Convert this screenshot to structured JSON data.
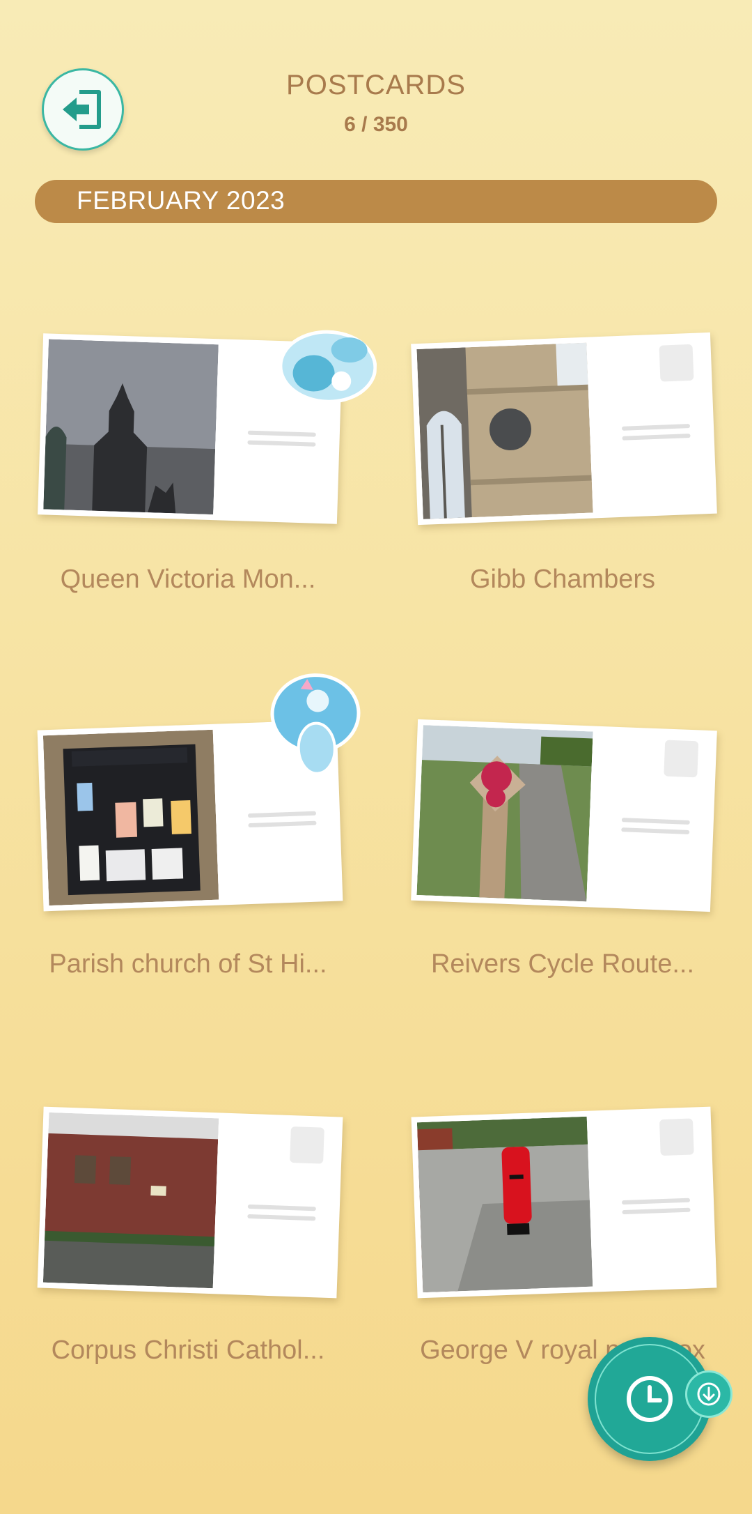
{
  "header": {
    "title": "POSTCARDS",
    "count": "6 / 350",
    "back_icon": "exit-door-icon"
  },
  "month": "FEBRUARY 2023",
  "postcards": [
    {
      "caption": "Queen Victoria Mon...",
      "has_sticker": true
    },
    {
      "caption": "Gibb Chambers",
      "has_sticker": false
    },
    {
      "caption": "Parish church of St Hi...",
      "has_sticker": true
    },
    {
      "caption": "Reivers Cycle Route...",
      "has_sticker": false
    },
    {
      "caption": "Corpus Christi Cathol...",
      "has_sticker": false
    },
    {
      "caption": "George V royal post box",
      "has_sticker": false
    }
  ],
  "fab": {
    "icon": "clock-icon",
    "sub_icon": "arrow-down-icon"
  },
  "colors": {
    "accent": "#1fa294",
    "month_bar": "#bc8a48",
    "text": "#b3885c"
  }
}
